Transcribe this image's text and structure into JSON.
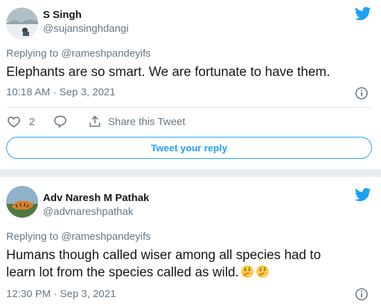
{
  "tweet1": {
    "author_name": "S Singh",
    "author_handle": "@sujansinghdangi",
    "replying_to": "Replying to @rameshpandeyifs",
    "text": "Elephants are so smart. We are fortunate to have them.",
    "timestamp": "10:18 AM · Sep 3, 2021",
    "like_count": "2",
    "share_label": "Share this Tweet",
    "reply_button_label": "Tweet your reply"
  },
  "tweet2": {
    "author_name": "Adv Naresh M Pathak",
    "author_handle": "@advnareshpathak",
    "replying_to": "Replying to @rameshpandeyifs",
    "text_line1": "Humans though called wiser among all species had to",
    "text_line2": "learn lot from the species called as wild.",
    "emoji": [
      "thinking-face",
      "thinking-face"
    ],
    "timestamp": "12:30 PM · Sep 3, 2021"
  },
  "icons": {
    "brand": "twitter-bird-icon",
    "info": "info-icon",
    "like": "heart-icon",
    "reply": "comment-icon",
    "share": "share-icon"
  },
  "colors": {
    "twitter_blue": "#1da1f2",
    "secondary_text": "#657786",
    "primary_text": "#14171a",
    "background": "#e6ecf0"
  }
}
